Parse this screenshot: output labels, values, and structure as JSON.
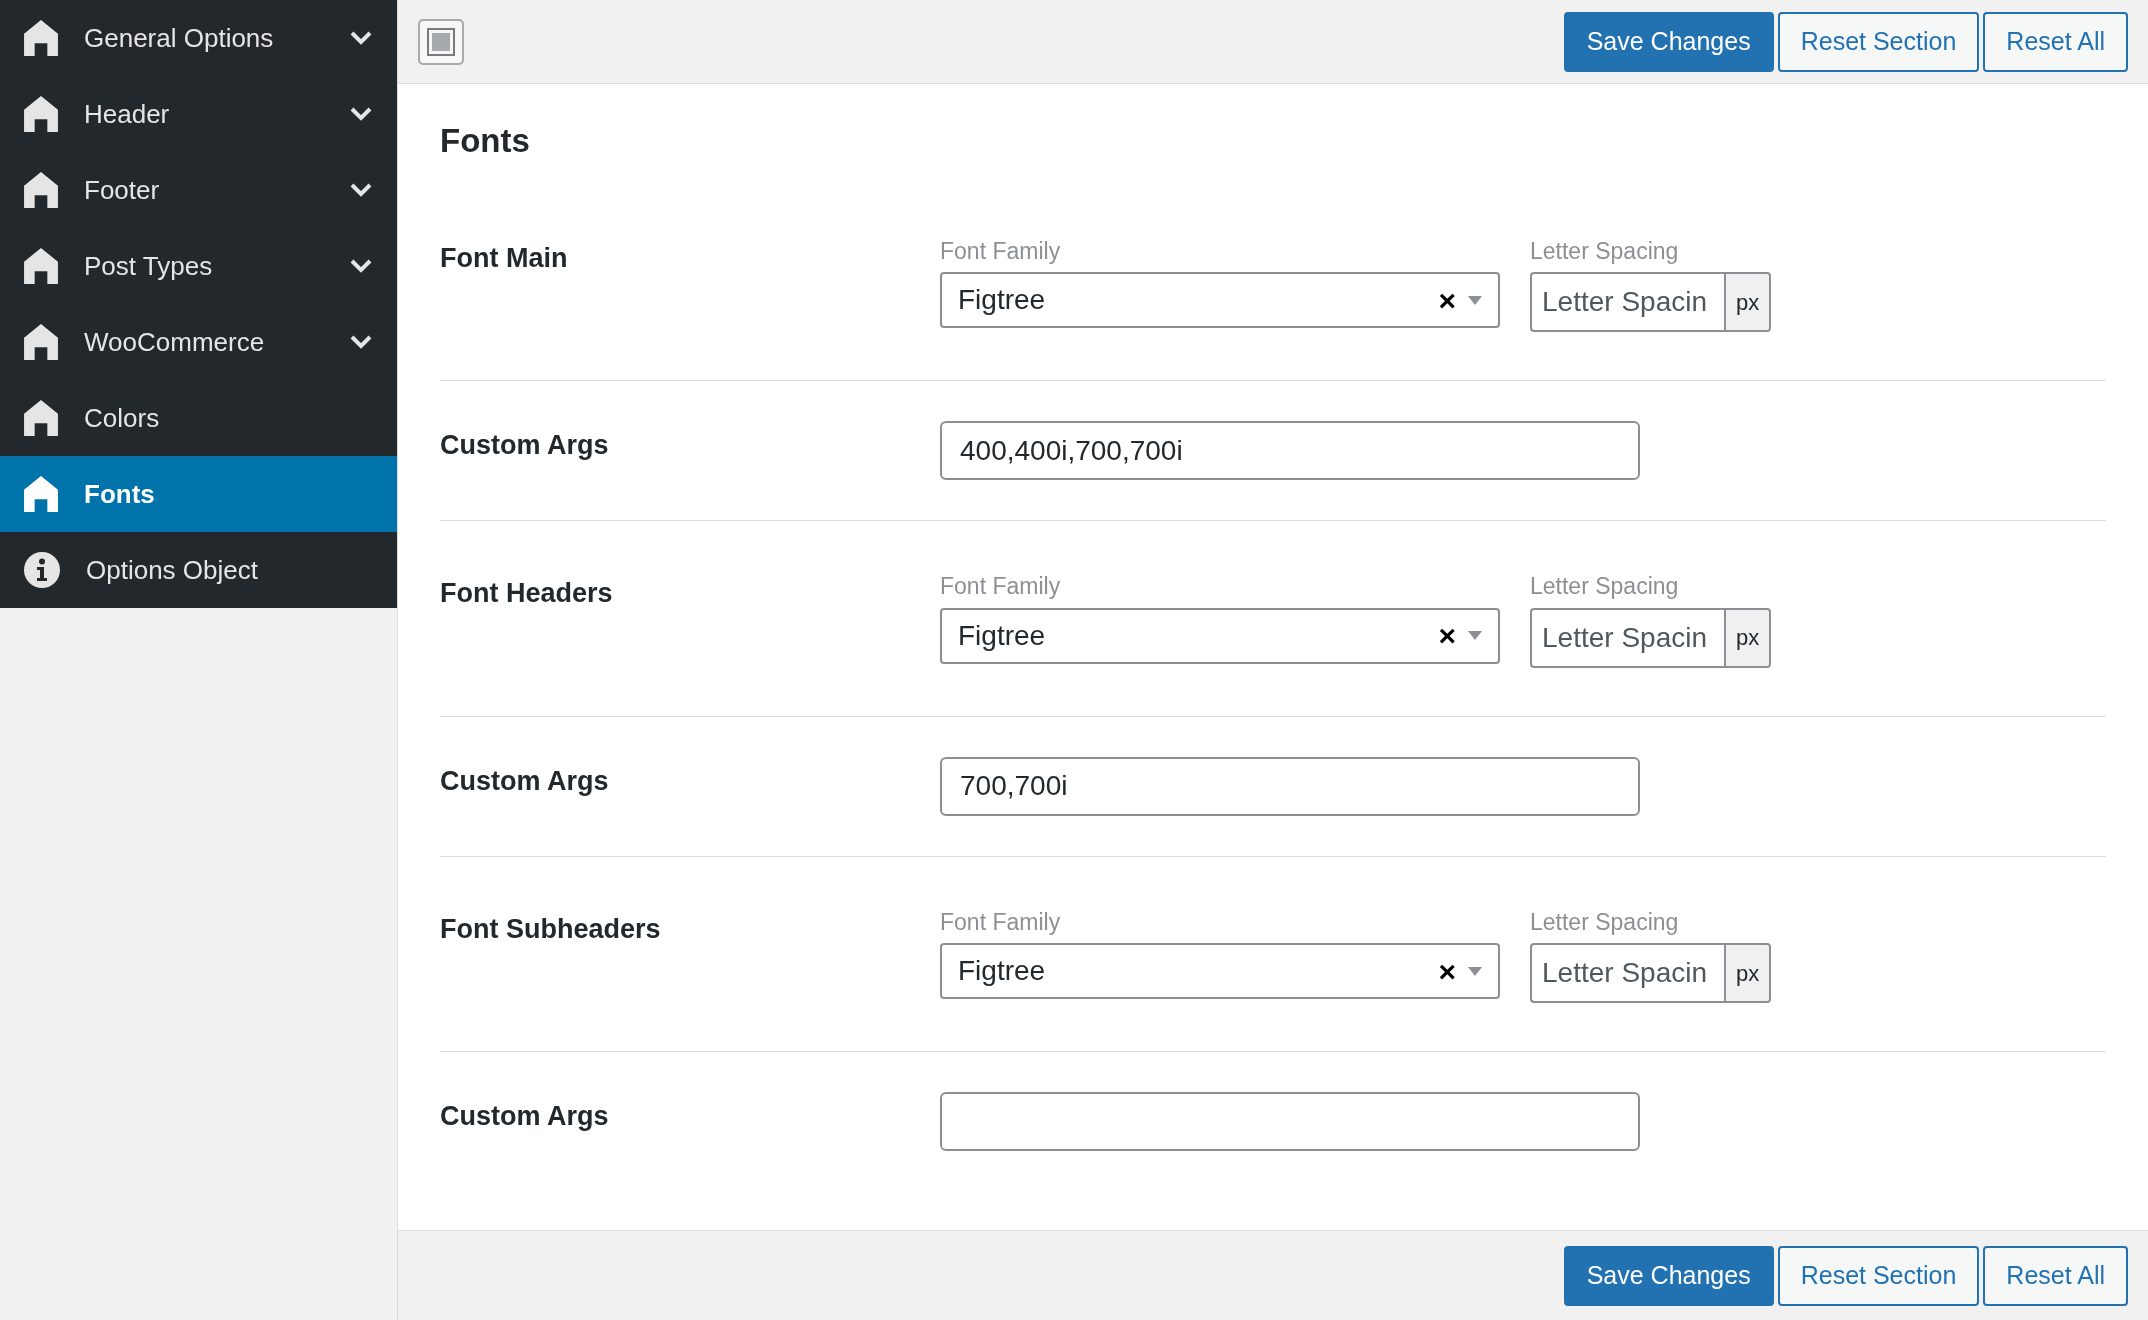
{
  "sidebar": {
    "items": [
      {
        "label": "General Options",
        "kind": "home",
        "expandable": true,
        "selected": false
      },
      {
        "label": "Header",
        "kind": "home",
        "expandable": true,
        "selected": false
      },
      {
        "label": "Footer",
        "kind": "home",
        "expandable": true,
        "selected": false
      },
      {
        "label": "Post Types",
        "kind": "home",
        "expandable": true,
        "selected": false
      },
      {
        "label": "WooCommerce",
        "kind": "home",
        "expandable": true,
        "selected": false
      },
      {
        "label": "Colors",
        "kind": "home",
        "expandable": false,
        "selected": false
      },
      {
        "label": "Fonts",
        "kind": "home",
        "expandable": false,
        "selected": true
      },
      {
        "label": "Options Object",
        "kind": "info",
        "expandable": false,
        "selected": false
      }
    ]
  },
  "top_bar": {
    "buttons": [
      {
        "label": "Save Changes",
        "kind": "primary"
      },
      {
        "label": "Reset Section",
        "kind": "secondary"
      },
      {
        "label": "Reset All",
        "kind": "secondary"
      }
    ]
  },
  "section": {
    "title": "Fonts",
    "fields": [
      {
        "kind": "font",
        "label": "Font Main",
        "family_label": "Font Family",
        "family_value": "Figtree",
        "clear": "×",
        "spacing_label": "Letter Spacing",
        "spacing_placeholder": "Letter Spacin",
        "unit": "px"
      },
      {
        "kind": "args",
        "label": "Custom Args",
        "value": "400,400i,700,700i"
      },
      {
        "kind": "font",
        "label": "Font Headers",
        "family_label": "Font Family",
        "family_value": "Figtree",
        "clear": "×",
        "spacing_label": "Letter Spacing",
        "spacing_placeholder": "Letter Spacin",
        "unit": "px"
      },
      {
        "kind": "args",
        "label": "Custom Args",
        "value": "700,700i"
      },
      {
        "kind": "font",
        "label": "Font Subheaders",
        "family_label": "Font Family",
        "family_value": "Figtree",
        "clear": "×",
        "spacing_label": "Letter Spacing",
        "spacing_placeholder": "Letter Spacin",
        "unit": "px"
      },
      {
        "kind": "args",
        "label": "Custom Args"
      }
    ]
  },
  "bottom_bar": {
    "buttons": [
      {
        "label": "Save Changes",
        "kind": "primary"
      },
      {
        "label": "Reset Section",
        "kind": "secondary"
      },
      {
        "label": "Reset All",
        "kind": "secondary"
      }
    ]
  }
}
